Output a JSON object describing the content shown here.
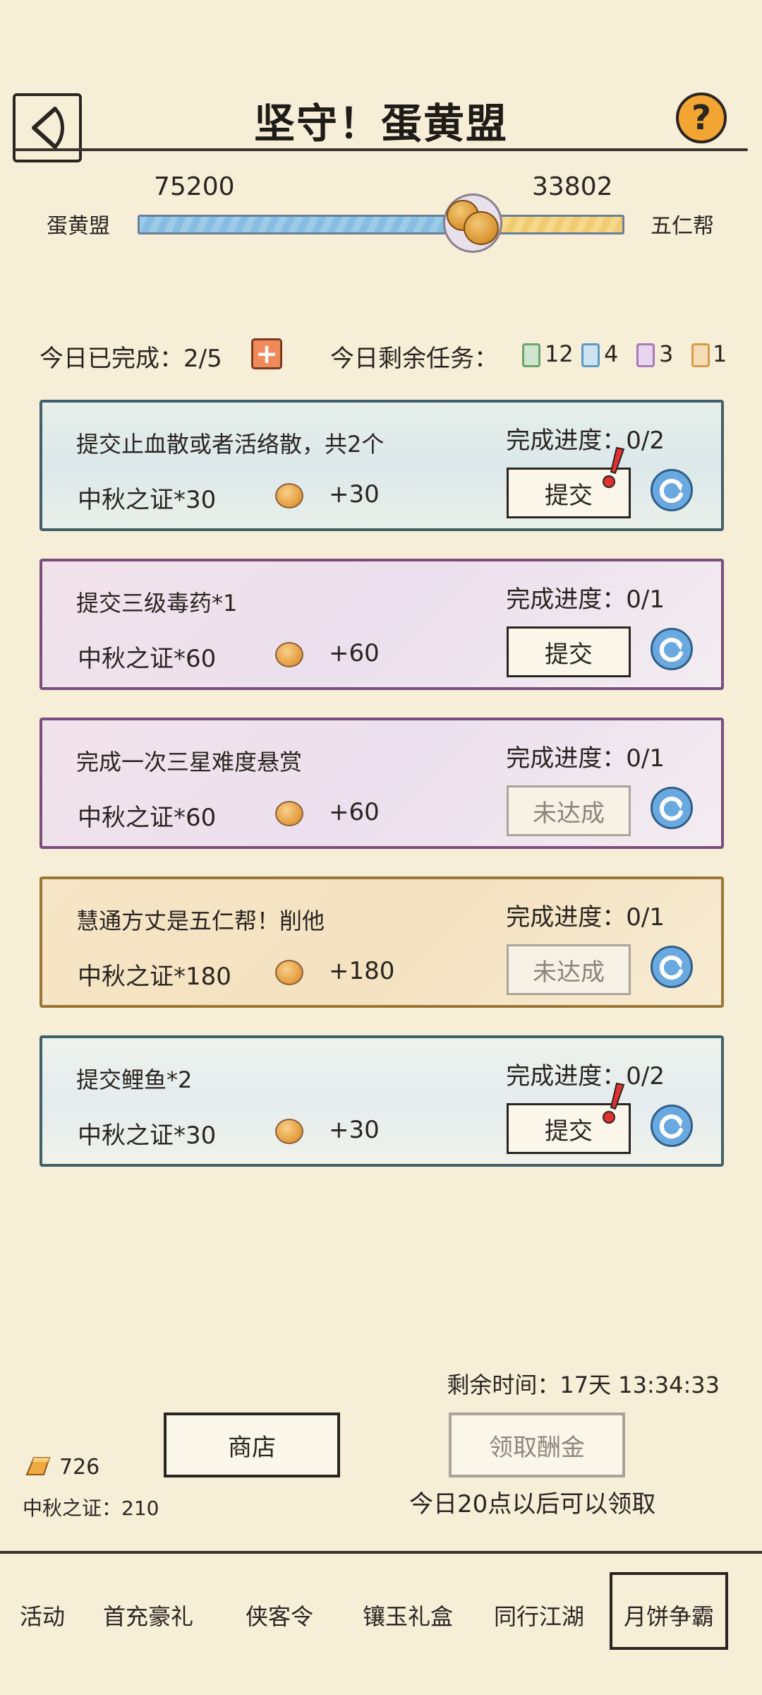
{
  "header": {
    "title": "坚守！蛋黄盟",
    "back_icon": "back-arrow-icon",
    "help_label": "?"
  },
  "versus": {
    "left_team": "蛋黄盟",
    "right_team": "五仁帮",
    "left_score": "75200",
    "right_score": "33802",
    "left_share": 0.69,
    "colors": {
      "left": "#9ccbe8",
      "right": "#f7d88a"
    }
  },
  "stats": {
    "done_label": "今日已完成：2/5",
    "remaining_label": "今日剩余任务：",
    "chips": [
      {
        "color": "#6aa56a",
        "count": "12"
      },
      {
        "color": "#5b9ac4",
        "count": "4"
      },
      {
        "color": "#a779b8",
        "count": "3"
      },
      {
        "color": "#d79b4a",
        "count": "1"
      }
    ]
  },
  "tasks": [
    {
      "name": "提交止血散或者活络散，共2个",
      "progress": "完成进度：0/2",
      "reward": "中秋之证*30",
      "points": "+30",
      "action": "提交",
      "alert": true
    },
    {
      "name": "提交三级毒药*1",
      "progress": "完成进度：0/1",
      "reward": "中秋之证*60",
      "points": "+60",
      "action": "提交",
      "alert": false
    },
    {
      "name": "完成一次三星难度悬赏",
      "progress": "完成进度：0/1",
      "reward": "中秋之证*60",
      "points": "+60",
      "action": "未达成",
      "alert": false
    },
    {
      "name": "慧通方丈是五仁帮！削他",
      "progress": "完成进度：0/1",
      "reward": "中秋之证*180",
      "points": "+180",
      "action": "未达成",
      "alert": false
    },
    {
      "name": "提交鲤鱼*2",
      "progress": "完成进度：0/2",
      "reward": "中秋之证*30",
      "points": "+30",
      "action": "提交",
      "alert": true
    }
  ],
  "footer": {
    "timer": "剩余时间：17天 13:34:33",
    "shop_label": "商店",
    "claim_label": "领取酬金",
    "claim_hint": "今日20点以后可以领取",
    "gold": "726",
    "token_label": "中秋之证：210"
  },
  "nav": {
    "items": [
      "活动",
      "首充豪礼",
      "侠客令",
      "镶玉礼盒",
      "同行江湖",
      "月饼争霸"
    ],
    "active_index": 5
  }
}
